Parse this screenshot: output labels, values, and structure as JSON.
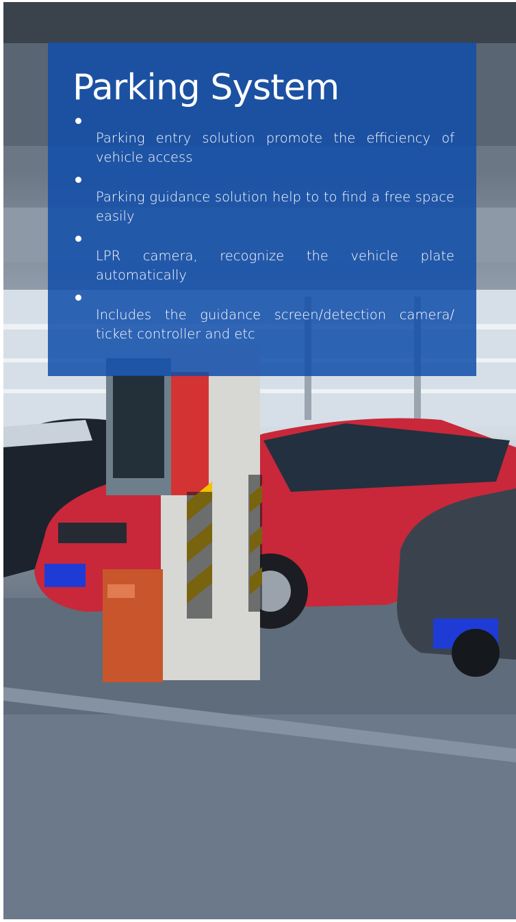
{
  "banner": {
    "title": "Parking System",
    "features": [
      "Parking entry solution promote the efficiency of vehicle access",
      "Parking guidance solution help to to find a free space easily",
      "LPR camera, recognize the vehicle plate automatically",
      "Includes the guidance screen/detection camera/ ticket controller and etc"
    ]
  },
  "colors": {
    "overlay": "#124eaa",
    "text": "#ffffff",
    "car_red": "#c8283a",
    "pillar_stripe_yellow": "#f2c200",
    "plate_blue": "#1f3bd6"
  }
}
